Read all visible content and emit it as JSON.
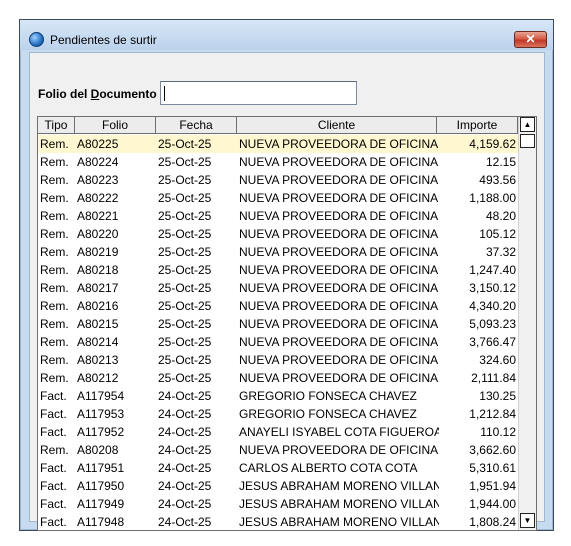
{
  "window": {
    "title": "Pendientes de surtir",
    "close_glyph": "✕"
  },
  "form": {
    "folio_label_pre": "Folio del ",
    "folio_label_u": "D",
    "folio_label_post": "ocumento",
    "folio_value": ""
  },
  "grid": {
    "columns": [
      "Tipo",
      "Folio",
      "Fecha",
      "Cliente",
      "Importe"
    ],
    "rows": [
      {
        "tipo": "Rem.",
        "folio": "A80225",
        "fecha": "25-Oct-25",
        "cliente": "NUEVA PROVEEDORA DE OFICINA",
        "importe": "4,159.62"
      },
      {
        "tipo": "Rem.",
        "folio": "A80224",
        "fecha": "25-Oct-25",
        "cliente": "NUEVA PROVEEDORA DE OFICINA",
        "importe": "12.15"
      },
      {
        "tipo": "Rem.",
        "folio": "A80223",
        "fecha": "25-Oct-25",
        "cliente": "NUEVA PROVEEDORA DE OFICINA",
        "importe": "493.56"
      },
      {
        "tipo": "Rem.",
        "folio": "A80222",
        "fecha": "25-Oct-25",
        "cliente": "NUEVA PROVEEDORA DE OFICINA",
        "importe": "1,188.00"
      },
      {
        "tipo": "Rem.",
        "folio": "A80221",
        "fecha": "25-Oct-25",
        "cliente": "NUEVA PROVEEDORA DE OFICINA",
        "importe": "48.20"
      },
      {
        "tipo": "Rem.",
        "folio": "A80220",
        "fecha": "25-Oct-25",
        "cliente": "NUEVA PROVEEDORA DE OFICINA",
        "importe": "105.12"
      },
      {
        "tipo": "Rem.",
        "folio": "A80219",
        "fecha": "25-Oct-25",
        "cliente": "NUEVA PROVEEDORA DE OFICINA",
        "importe": "37.32"
      },
      {
        "tipo": "Rem.",
        "folio": "A80218",
        "fecha": "25-Oct-25",
        "cliente": "NUEVA PROVEEDORA DE OFICINA",
        "importe": "1,247.40"
      },
      {
        "tipo": "Rem.",
        "folio": "A80217",
        "fecha": "25-Oct-25",
        "cliente": "NUEVA PROVEEDORA DE OFICINA",
        "importe": "3,150.12"
      },
      {
        "tipo": "Rem.",
        "folio": "A80216",
        "fecha": "25-Oct-25",
        "cliente": "NUEVA PROVEEDORA DE OFICINA",
        "importe": "4,340.20"
      },
      {
        "tipo": "Rem.",
        "folio": "A80215",
        "fecha": "25-Oct-25",
        "cliente": "NUEVA PROVEEDORA DE OFICINA",
        "importe": "5,093.23"
      },
      {
        "tipo": "Rem.",
        "folio": "A80214",
        "fecha": "25-Oct-25",
        "cliente": "NUEVA PROVEEDORA DE OFICINA",
        "importe": "3,766.47"
      },
      {
        "tipo": "Rem.",
        "folio": "A80213",
        "fecha": "25-Oct-25",
        "cliente": "NUEVA PROVEEDORA DE OFICINA",
        "importe": "324.60"
      },
      {
        "tipo": "Rem.",
        "folio": "A80212",
        "fecha": "25-Oct-25",
        "cliente": "NUEVA PROVEEDORA DE OFICINA",
        "importe": "2,111.84"
      },
      {
        "tipo": "Fact.",
        "folio": "A117954",
        "fecha": "24-Oct-25",
        "cliente": "GREGORIO FONSECA CHAVEZ",
        "importe": "130.25"
      },
      {
        "tipo": "Fact.",
        "folio": "A117953",
        "fecha": "24-Oct-25",
        "cliente": "GREGORIO FONSECA CHAVEZ",
        "importe": "1,212.84"
      },
      {
        "tipo": "Fact.",
        "folio": "A117952",
        "fecha": "24-Oct-25",
        "cliente": "ANAYELI ISYABEL COTA FIGUEROA",
        "importe": "110.12"
      },
      {
        "tipo": "Rem.",
        "folio": "A80208",
        "fecha": "24-Oct-25",
        "cliente": "NUEVA PROVEEDORA DE OFICINA",
        "importe": "3,662.60"
      },
      {
        "tipo": "Fact.",
        "folio": "A117951",
        "fecha": "24-Oct-25",
        "cliente": "CARLOS ALBERTO COTA COTA",
        "importe": "5,310.61"
      },
      {
        "tipo": "Fact.",
        "folio": "A117950",
        "fecha": "24-Oct-25",
        "cliente": "JESUS ABRAHAM MORENO VILLAN",
        "importe": "1,951.94"
      },
      {
        "tipo": "Fact.",
        "folio": "A117949",
        "fecha": "24-Oct-25",
        "cliente": "JESUS ABRAHAM MORENO VILLAN",
        "importe": "1,944.00"
      },
      {
        "tipo": "Fact.",
        "folio": "A117948",
        "fecha": "24-Oct-25",
        "cliente": "JESUS ABRAHAM MORENO VILLAN",
        "importe": "1,808.24"
      }
    ],
    "selected_index": 0
  },
  "scrollbar": {
    "up_glyph": "▲",
    "down_glyph": "▼"
  },
  "colors": {
    "selected_row": "#fff7cf",
    "titlebar": "#c7dbf0",
    "close_button": "#c0392b"
  }
}
